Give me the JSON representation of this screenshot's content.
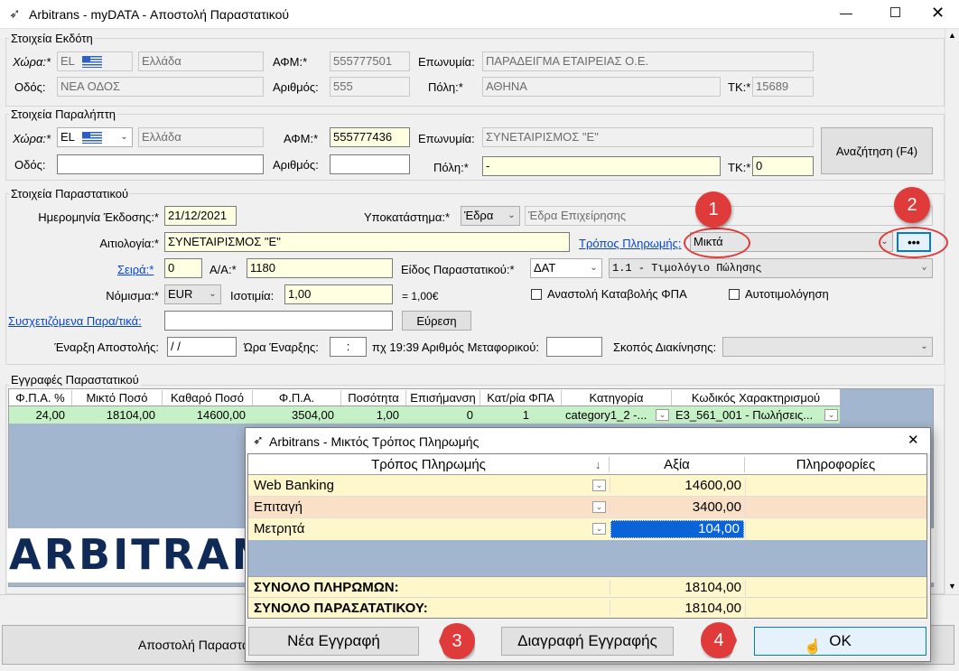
{
  "window": {
    "title": "Arbitrans - myDATA - Αποστολή Παραστατικού"
  },
  "issuer": {
    "section_title": "Στοιχεία Εκδότη",
    "country_label": "Χώρα:*",
    "country_code": "EL",
    "country_name": "Ελλάδα",
    "afm_label": "ΑΦΜ:*",
    "afm": "555777501",
    "name_label": "Επωνυμία:",
    "name": "ΠΑΡΑΔΕΙΓΜΑ ΕΤΑΙΡΕΙΑΣ Ο.Ε.",
    "street_label": "Οδός:",
    "street": "ΝΕΑ ΟΔΟΣ",
    "number_label": "Αριθμός:",
    "number": "555",
    "city_label": "Πόλη:*",
    "city": "ΑΘΗΝΑ",
    "zip_label": "ΤΚ:*",
    "zip": "15689"
  },
  "recipient": {
    "section_title": "Στοιχεία Παραλήπτη",
    "country_label": "Χώρα:*",
    "country_code": "EL",
    "country_name": "Ελλάδα",
    "afm_label": "ΑΦΜ:*",
    "afm": "555777436",
    "name_label": "Επωνυμία:",
    "name": "ΣΥΝΕΤΑΙΡΙΣΜΟΣ \"Ε\"",
    "street_label": "Οδός:",
    "street": "",
    "number_label": "Αριθμός:",
    "number": "",
    "city_label": "Πόλη:*",
    "city": "-",
    "zip_label": "ΤΚ:*",
    "zip": "0",
    "search_button": "Αναζήτηση (F4)"
  },
  "document": {
    "section_title": "Στοιχεία Παραστατικού",
    "issue_date_label": "Ημερομηνία Έκδοσης:*",
    "issue_date": "21/12/2021",
    "branch_label": "Υποκατάστημα:*",
    "branch": "Έδρα",
    "branch_desc": "Έδρα Επιχείρησης",
    "reason_label": "Αιτιολογία:*",
    "reason": "ΣΥΝΕΤΑΙΡΙΣΜΟΣ \"Ε\"",
    "payment_method_label": "Τρόπος Πληρωμής:",
    "payment_method": "Μικτά",
    "more_button": "•••",
    "series_label": "Σειρά:*",
    "series": "0",
    "aa_label": "Α/Α:*",
    "aa": "1180",
    "doc_type_label": "Είδος Παραστατικού:*",
    "doc_type": "ΔΑΤ",
    "doc_type_desc": "1.1 - Τιμολόγιο Πώλησης",
    "currency_label": "Νόμισμα:*",
    "currency": "EUR",
    "parity_label": "Ισοτιμία:",
    "parity": "1,00",
    "parity_eq": "= 1,00€",
    "vat_suspend_label": "Αναστολή Καταβολής ΦΠΑ",
    "self_billing_label": "Αυτοτιμολόγηση",
    "related_label": "Συσχετιζόμενα Παρα/τικά:",
    "related": "",
    "find_button": "Εύρεση",
    "dispatch_start_label": "Έναρξη Αποστολής:",
    "dispatch_date": " / /",
    "start_time_label": "Ώρα Έναρξης:",
    "start_time": ":",
    "vehicle_label": "πχ 19:39 Αριθμός Μεταφορικού:",
    "vehicle": "",
    "purpose_label": "Σκοπός Διακίνησης:",
    "purpose": ""
  },
  "entries": {
    "section_title": "Εγγραφές Παραστατικού",
    "columns": [
      "Φ.Π.Α. %",
      "Μικτό Ποσό",
      "Καθαρό Ποσό",
      "Φ.Π.Α.",
      "Ποσότητα",
      "Επισήμανση",
      "Κατ/ρία ΦΠΑ",
      "Κατηγορία",
      "Κωδικός Χαρακτηρισμού"
    ],
    "row": [
      "24,00",
      "18104,00",
      "14600,00",
      "3504,00",
      "1,00",
      "0",
      "1",
      "category1_2  -...",
      "E3_561_001 - Πωλήσεις..."
    ]
  },
  "logo_text": "ARBITRANS",
  "bottom": {
    "send_button": "Αποστολή Παραστατικού"
  },
  "dialog": {
    "title": "Arbitrans - Μικτός Τρόπος Πληρωμής",
    "columns": [
      "Τρόπος Πληρωμής",
      "Αξία",
      "Πληροφορίες"
    ],
    "rows": [
      {
        "method": "Web Banking",
        "amount": "14600,00",
        "info": ""
      },
      {
        "method": "Επιταγή",
        "amount": "3400,00",
        "info": ""
      },
      {
        "method": "Μετρητά",
        "amount": "104,00",
        "info": ""
      }
    ],
    "total_payments_label": "ΣΥΝΟΛΟ ΠΛΗΡΩΜΩΝ:",
    "total_payments": "18104,00",
    "total_document_label": "ΣΥΝΟΛΟ ΠΑΡΑΣΑΤΑΤΙΚΟΥ:",
    "total_document": "18104,00",
    "new_button": "Νέα Εγγραφή",
    "delete_button": "Διαγραφή Εγγραφής",
    "ok_button": "OK"
  },
  "callouts": [
    "1",
    "2",
    "3",
    "4"
  ],
  "colors": {
    "accent_red": "#e03b3b",
    "required_yellow": "#ffffe1",
    "row_green": "#c6f0c6",
    "selection_blue": "#0a64d8"
  }
}
